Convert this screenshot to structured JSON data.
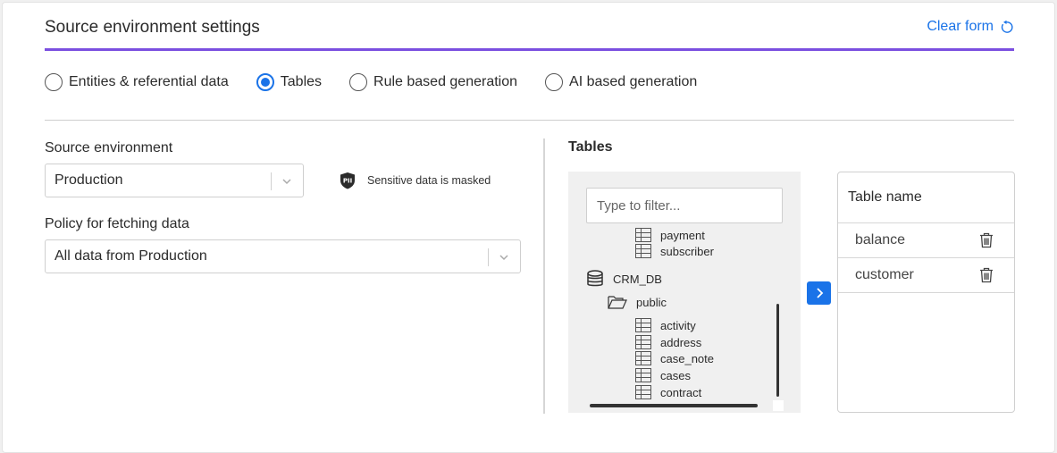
{
  "header": {
    "title": "Source environment settings",
    "clear_form_label": "Clear form",
    "accent_color": "#7b4fe0",
    "link_color": "#1a73e8"
  },
  "mode_options": [
    {
      "label": "Entities & referential data",
      "checked": false
    },
    {
      "label": "Tables",
      "checked": true
    },
    {
      "label": "Rule based generation",
      "checked": false
    },
    {
      "label": "AI based generation",
      "checked": false
    }
  ],
  "source_environment": {
    "label": "Source environment",
    "value": "Production"
  },
  "pii_notice": {
    "icon": "pii-shield-icon",
    "text": "Sensitive data is masked"
  },
  "policy": {
    "label": "Policy for fetching data",
    "value": "All data from Production"
  },
  "tables": {
    "title": "Tables",
    "filter_placeholder": "Type to filter...",
    "tree": {
      "top_tables": [
        "payment",
        "subscriber"
      ],
      "database": "CRM_DB",
      "schema": "public",
      "schema_tables": [
        "activity",
        "address",
        "case_note",
        "cases",
        "contract"
      ]
    },
    "selected": {
      "column_header": "Table name",
      "rows": [
        "balance",
        "customer"
      ]
    }
  }
}
